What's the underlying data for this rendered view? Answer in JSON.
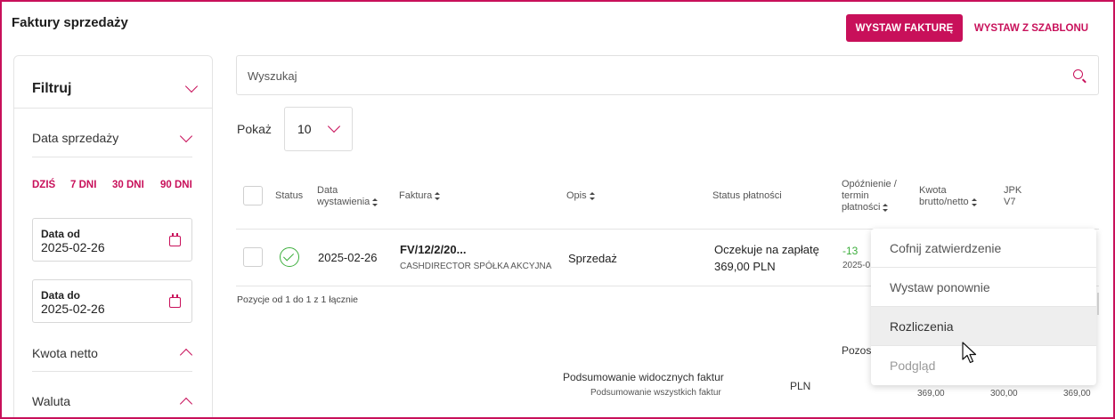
{
  "header": {
    "title": "Faktury sprzedaży",
    "primary_button": "WYSTAW FAKTURĘ",
    "secondary_button": "WYSTAW Z SZABLONU"
  },
  "filter": {
    "title": "Filtruj",
    "sale_date_label": "Data sprzedaży",
    "quick_ranges": [
      "DZIŚ",
      "7 DNI",
      "30 DNI",
      "90 DNI"
    ],
    "date_from_label": "Data od",
    "date_from_value": "2025-02-26",
    "date_to_label": "Data do",
    "date_to_value": "2025-02-26",
    "net_amount_label": "Kwota netto",
    "currency_label": "Waluta"
  },
  "search": {
    "placeholder": "Wyszukaj"
  },
  "paging": {
    "show_label": "Pokaż",
    "page_size": "10",
    "summary": "Pozycje od 1 do 1 z 1 łącznie"
  },
  "table": {
    "headers": {
      "status": "Status",
      "issue_date": "Data wystawienia",
      "invoice": "Faktura",
      "description": "Opis",
      "payment_status": "Status płatności",
      "delay": "Opóźnienie / termin płatności",
      "amount": "Kwota brutto/netto",
      "jpk": "JPK V7"
    },
    "rows": [
      {
        "issue_date": "2025-02-26",
        "invoice_number": "FV/12/2/20...",
        "client": "CASHDIRECTOR SPÓŁKA AKCYJNA",
        "description": "Sprzedaż",
        "payment_status": "Oczekuje na zapłatę",
        "payment_amount": "369,00 PLN",
        "delay_days": "-13",
        "due_date_partial": "2025-0"
      }
    ]
  },
  "summary": {
    "remaining_partial": "Pozos",
    "visible_label": "Podsumowanie widocznych faktur",
    "all_label": "Podsumowanie wszystkich faktur",
    "currency": "PLN",
    "values": [
      "369,00",
      "300,00",
      "369,00"
    ]
  },
  "context_menu": {
    "items": [
      "Cofnij zatwierdzenie",
      "Wystaw ponownie",
      "Rozliczenia",
      "Podgląd"
    ]
  },
  "colors": {
    "accent": "#c8105a",
    "success": "#3cae3c",
    "negative_delay": "#3cae3c"
  }
}
